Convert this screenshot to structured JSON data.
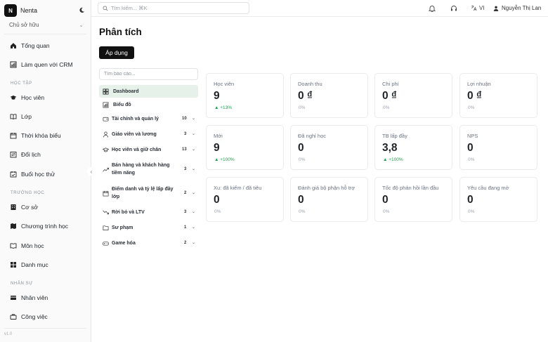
{
  "app": {
    "logo_letter": "N",
    "name": "Nenta"
  },
  "sidebar": {
    "role": "Chủ sở hữu",
    "items_top": [
      {
        "id": "overview",
        "label": "Tổng quan",
        "icon": "home-icon"
      },
      {
        "id": "crm",
        "label": "Làm quen với CRM",
        "icon": "chart-icon"
      }
    ],
    "section_study": "HỌC TẬP",
    "items_study": [
      {
        "id": "students",
        "label": "Học viên",
        "icon": "graduation-cap-icon"
      },
      {
        "id": "classes",
        "label": "Lớp",
        "icon": "book-open-icon"
      },
      {
        "id": "timetable",
        "label": "Thời khóa biểu",
        "icon": "calendar-icon"
      },
      {
        "id": "reschedule",
        "label": "Đổi lịch",
        "icon": "swap-icon"
      },
      {
        "id": "trial",
        "label": "Buổi học thử",
        "icon": "calendar-check-icon"
      }
    ],
    "section_school": "TRƯỜNG HỌC",
    "items_school": [
      {
        "id": "campus",
        "label": "Cơ sở",
        "icon": "building-icon"
      },
      {
        "id": "programs",
        "label": "Chương trình học",
        "icon": "map-icon"
      },
      {
        "id": "subjects",
        "label": "Môn học",
        "icon": "book-icon"
      },
      {
        "id": "categories",
        "label": "Danh mục",
        "icon": "grid-icon"
      }
    ],
    "section_hr": "NHÂN SỰ",
    "items_hr": [
      {
        "id": "staff",
        "label": "Nhân viên",
        "icon": "id-card-icon"
      },
      {
        "id": "jobs",
        "label": "Công việc",
        "icon": "briefcase-icon"
      }
    ],
    "version": "v1.0"
  },
  "topbar": {
    "search_placeholder": "Tìm kiếm... ⌘K",
    "language": "VI",
    "user_name": "Nguyễn Thị Lan"
  },
  "main": {
    "title": "Phân tích",
    "apply_label": "Áp dụng",
    "report_search_placeholder": "Tìm báo cáo...",
    "reports": [
      {
        "label": "Dashboard",
        "count": "",
        "active": true,
        "icon": "dashboard-icon"
      },
      {
        "label": "Biểu đồ",
        "count": "",
        "active": false,
        "icon": "bar-chart-icon"
      },
      {
        "label": "Tài chính và quản lý",
        "count": "10",
        "active": false,
        "icon": "wallet-icon"
      },
      {
        "label": "Giáo viên và lương",
        "count": "3",
        "active": false,
        "icon": "user-icon"
      },
      {
        "label": "Học viên và giữ chân",
        "count": "13",
        "active": false,
        "icon": "graduation-cap-icon"
      },
      {
        "label": "Bán hàng và khách hàng tiềm năng",
        "count": "3",
        "active": false,
        "icon": "trending-up-icon"
      },
      {
        "label": "Điểm danh và tỷ lệ lấp đầy lớp",
        "count": "2",
        "active": false,
        "icon": "calendar-icon"
      },
      {
        "label": "Rời bỏ và LTV",
        "count": "3",
        "active": false,
        "icon": "trending-down-icon"
      },
      {
        "label": "Sư phạm",
        "count": "1",
        "active": false,
        "icon": "folder-icon"
      },
      {
        "label": "Game hóa",
        "count": "2",
        "active": false,
        "icon": "gamepad-icon"
      }
    ],
    "cards": [
      {
        "title": "Học viên",
        "value": "9",
        "change": "▲ +13%",
        "up": true
      },
      {
        "title": "Doanh thu",
        "value": "0 ₫",
        "change": "0%",
        "up": false
      },
      {
        "title": "Chi phí",
        "value": "0 ₫",
        "change": "0%",
        "up": false
      },
      {
        "title": "Lợi nhuận",
        "value": "0 ₫",
        "change": "0%",
        "up": false
      },
      {
        "title": "Mới",
        "value": "9",
        "change": "▲ +100%",
        "up": true
      },
      {
        "title": "Đã nghỉ học",
        "value": "0",
        "change": "0%",
        "up": false
      },
      {
        "title": "TB lấp đầy",
        "value": "3,8",
        "change": "▲ +100%",
        "up": true
      },
      {
        "title": "NPS",
        "value": "0",
        "change": "0%",
        "up": false
      },
      {
        "title": "Xu: đã kiếm / đã tiêu",
        "value": "0",
        "change": "0%",
        "up": false
      },
      {
        "title": "Đánh giá bộ phận hỗ trợ",
        "value": "0",
        "change": "0%",
        "up": false
      },
      {
        "title": "Tốc độ phản hồi lần đầu",
        "value": "0",
        "change": "0%",
        "up": false
      },
      {
        "title": "Yêu cầu đang mở",
        "value": "0",
        "change": "0%",
        "up": false
      }
    ]
  },
  "colors": {
    "accent": "#111111",
    "active_bg": "#e6f1ea",
    "positive": "#16a34a"
  }
}
